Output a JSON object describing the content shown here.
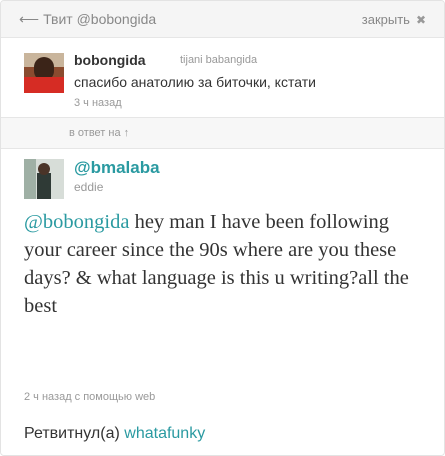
{
  "header": {
    "back_arrow": "⟵",
    "back_label": "Твит @bobongida",
    "close_label": "закрыть",
    "close_icon": "✖"
  },
  "reply_tweet": {
    "username": "bobongida",
    "display_name": "tijani babangida",
    "text": "спасибо анатолию за биточки, кстати",
    "time": "3 ч назад",
    "avatar_icon": "user-avatar-photo"
  },
  "divider": {
    "label": "в ответ на ↑"
  },
  "main_tweet": {
    "username": "@bmalaba",
    "display_name": "eddie",
    "mention": "@bobongida",
    "text": " hey man I have been following your career since the 90s where are you these days? & what language is this u writing?all the best",
    "time": "2 ч назад",
    "via_label": "с помощью",
    "source": "web",
    "avatar_icon": "user-avatar-photo"
  },
  "retweet": {
    "label": "Ретвитнул(а)",
    "user": "whatafunky"
  },
  "colors": {
    "link": "#2a9aa1",
    "text": "#333333",
    "muted": "#999999",
    "header_bg": "#f5f5f5"
  }
}
